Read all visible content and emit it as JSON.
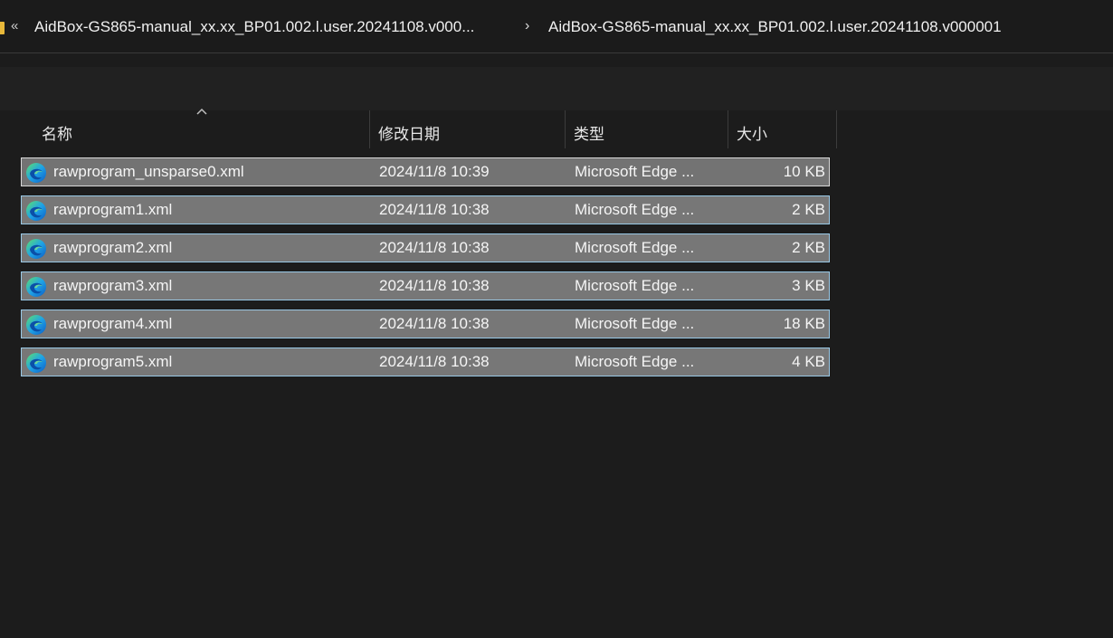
{
  "address": {
    "lead_sep": "«",
    "crumb1": "AidBox-GS865-manual_xx.xx_BP01.002.l.user.20241108.v000...",
    "arrow": "›",
    "crumb2": "AidBox-GS865-manual_xx.xx_BP01.002.l.user.20241108.v000001"
  },
  "columns": {
    "name": "名称",
    "date": "修改日期",
    "type": "类型",
    "size": "大小"
  },
  "files": [
    {
      "name": "rawprogram_unsparse0.xml",
      "date": "2024/11/8 10:39",
      "type": "Microsoft Edge ...",
      "size": "10 KB"
    },
    {
      "name": "rawprogram1.xml",
      "date": "2024/11/8 10:38",
      "type": "Microsoft Edge ...",
      "size": "2 KB"
    },
    {
      "name": "rawprogram2.xml",
      "date": "2024/11/8 10:38",
      "type": "Microsoft Edge ...",
      "size": "2 KB"
    },
    {
      "name": "rawprogram3.xml",
      "date": "2024/11/8 10:38",
      "type": "Microsoft Edge ...",
      "size": "3 KB"
    },
    {
      "name": "rawprogram4.xml",
      "date": "2024/11/8 10:38",
      "type": "Microsoft Edge ...",
      "size": "18 KB"
    },
    {
      "name": "rawprogram5.xml",
      "date": "2024/11/8 10:38",
      "type": "Microsoft Edge ...",
      "size": "4 KB"
    }
  ],
  "colors": {
    "folder": "#e8b83a",
    "selection_fill": "#777777",
    "selection_border": "#99c9e6"
  }
}
